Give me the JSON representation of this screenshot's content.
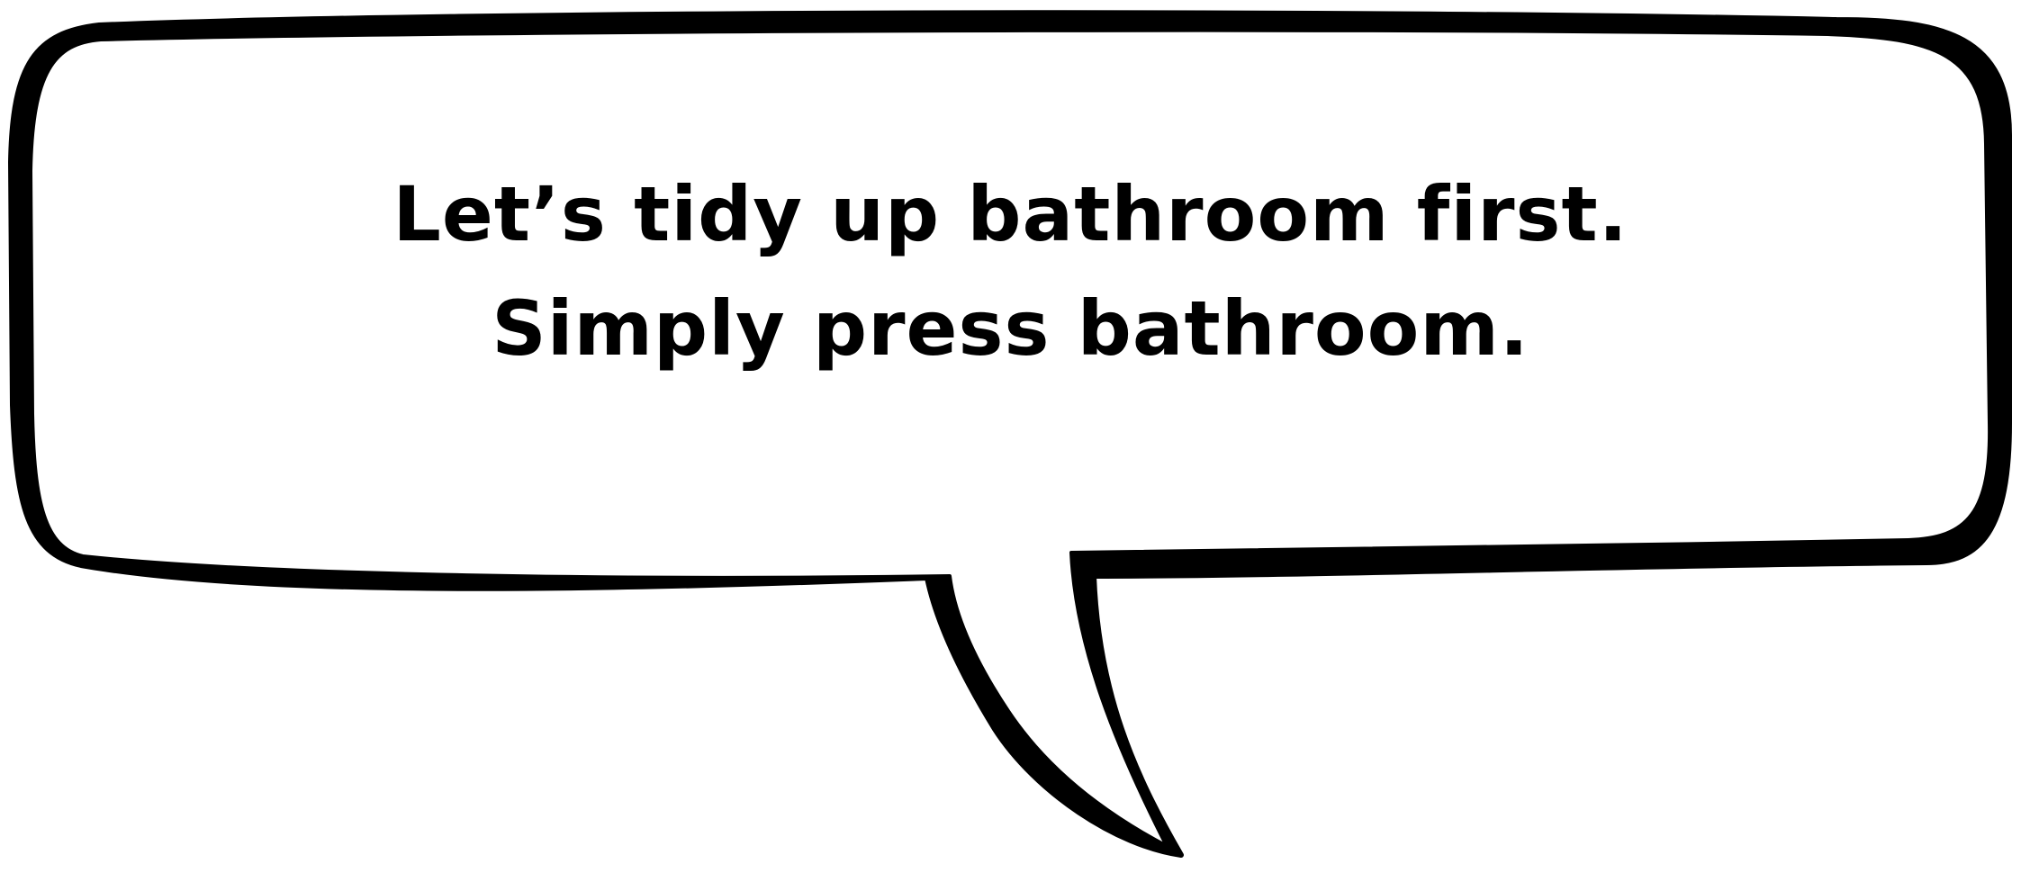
{
  "speech_bubble": {
    "lines": [
      "Let’s tidy up bathroom first.",
      "Simply press bathroom."
    ],
    "text_color": "#000000",
    "outline_color": "#000000",
    "fill_color": "#ffffff"
  }
}
